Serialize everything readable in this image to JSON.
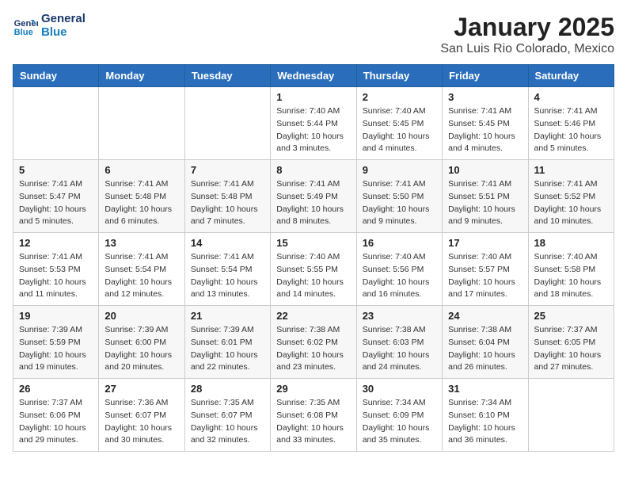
{
  "header": {
    "logo_line1": "General",
    "logo_line2": "Blue",
    "title": "January 2025",
    "subtitle": "San Luis Rio Colorado, Mexico"
  },
  "weekdays": [
    "Sunday",
    "Monday",
    "Tuesday",
    "Wednesday",
    "Thursday",
    "Friday",
    "Saturday"
  ],
  "weeks": [
    [
      {
        "day": "",
        "sunrise": "",
        "sunset": "",
        "daylight": ""
      },
      {
        "day": "",
        "sunrise": "",
        "sunset": "",
        "daylight": ""
      },
      {
        "day": "",
        "sunrise": "",
        "sunset": "",
        "daylight": ""
      },
      {
        "day": "1",
        "sunrise": "Sunrise: 7:40 AM",
        "sunset": "Sunset: 5:44 PM",
        "daylight": "Daylight: 10 hours and 3 minutes."
      },
      {
        "day": "2",
        "sunrise": "Sunrise: 7:40 AM",
        "sunset": "Sunset: 5:45 PM",
        "daylight": "Daylight: 10 hours and 4 minutes."
      },
      {
        "day": "3",
        "sunrise": "Sunrise: 7:41 AM",
        "sunset": "Sunset: 5:45 PM",
        "daylight": "Daylight: 10 hours and 4 minutes."
      },
      {
        "day": "4",
        "sunrise": "Sunrise: 7:41 AM",
        "sunset": "Sunset: 5:46 PM",
        "daylight": "Daylight: 10 hours and 5 minutes."
      }
    ],
    [
      {
        "day": "5",
        "sunrise": "Sunrise: 7:41 AM",
        "sunset": "Sunset: 5:47 PM",
        "daylight": "Daylight: 10 hours and 5 minutes."
      },
      {
        "day": "6",
        "sunrise": "Sunrise: 7:41 AM",
        "sunset": "Sunset: 5:48 PM",
        "daylight": "Daylight: 10 hours and 6 minutes."
      },
      {
        "day": "7",
        "sunrise": "Sunrise: 7:41 AM",
        "sunset": "Sunset: 5:48 PM",
        "daylight": "Daylight: 10 hours and 7 minutes."
      },
      {
        "day": "8",
        "sunrise": "Sunrise: 7:41 AM",
        "sunset": "Sunset: 5:49 PM",
        "daylight": "Daylight: 10 hours and 8 minutes."
      },
      {
        "day": "9",
        "sunrise": "Sunrise: 7:41 AM",
        "sunset": "Sunset: 5:50 PM",
        "daylight": "Daylight: 10 hours and 9 minutes."
      },
      {
        "day": "10",
        "sunrise": "Sunrise: 7:41 AM",
        "sunset": "Sunset: 5:51 PM",
        "daylight": "Daylight: 10 hours and 9 minutes."
      },
      {
        "day": "11",
        "sunrise": "Sunrise: 7:41 AM",
        "sunset": "Sunset: 5:52 PM",
        "daylight": "Daylight: 10 hours and 10 minutes."
      }
    ],
    [
      {
        "day": "12",
        "sunrise": "Sunrise: 7:41 AM",
        "sunset": "Sunset: 5:53 PM",
        "daylight": "Daylight: 10 hours and 11 minutes."
      },
      {
        "day": "13",
        "sunrise": "Sunrise: 7:41 AM",
        "sunset": "Sunset: 5:54 PM",
        "daylight": "Daylight: 10 hours and 12 minutes."
      },
      {
        "day": "14",
        "sunrise": "Sunrise: 7:41 AM",
        "sunset": "Sunset: 5:54 PM",
        "daylight": "Daylight: 10 hours and 13 minutes."
      },
      {
        "day": "15",
        "sunrise": "Sunrise: 7:40 AM",
        "sunset": "Sunset: 5:55 PM",
        "daylight": "Daylight: 10 hours and 14 minutes."
      },
      {
        "day": "16",
        "sunrise": "Sunrise: 7:40 AM",
        "sunset": "Sunset: 5:56 PM",
        "daylight": "Daylight: 10 hours and 16 minutes."
      },
      {
        "day": "17",
        "sunrise": "Sunrise: 7:40 AM",
        "sunset": "Sunset: 5:57 PM",
        "daylight": "Daylight: 10 hours and 17 minutes."
      },
      {
        "day": "18",
        "sunrise": "Sunrise: 7:40 AM",
        "sunset": "Sunset: 5:58 PM",
        "daylight": "Daylight: 10 hours and 18 minutes."
      }
    ],
    [
      {
        "day": "19",
        "sunrise": "Sunrise: 7:39 AM",
        "sunset": "Sunset: 5:59 PM",
        "daylight": "Daylight: 10 hours and 19 minutes."
      },
      {
        "day": "20",
        "sunrise": "Sunrise: 7:39 AM",
        "sunset": "Sunset: 6:00 PM",
        "daylight": "Daylight: 10 hours and 20 minutes."
      },
      {
        "day": "21",
        "sunrise": "Sunrise: 7:39 AM",
        "sunset": "Sunset: 6:01 PM",
        "daylight": "Daylight: 10 hours and 22 minutes."
      },
      {
        "day": "22",
        "sunrise": "Sunrise: 7:38 AM",
        "sunset": "Sunset: 6:02 PM",
        "daylight": "Daylight: 10 hours and 23 minutes."
      },
      {
        "day": "23",
        "sunrise": "Sunrise: 7:38 AM",
        "sunset": "Sunset: 6:03 PM",
        "daylight": "Daylight: 10 hours and 24 minutes."
      },
      {
        "day": "24",
        "sunrise": "Sunrise: 7:38 AM",
        "sunset": "Sunset: 6:04 PM",
        "daylight": "Daylight: 10 hours and 26 minutes."
      },
      {
        "day": "25",
        "sunrise": "Sunrise: 7:37 AM",
        "sunset": "Sunset: 6:05 PM",
        "daylight": "Daylight: 10 hours and 27 minutes."
      }
    ],
    [
      {
        "day": "26",
        "sunrise": "Sunrise: 7:37 AM",
        "sunset": "Sunset: 6:06 PM",
        "daylight": "Daylight: 10 hours and 29 minutes."
      },
      {
        "day": "27",
        "sunrise": "Sunrise: 7:36 AM",
        "sunset": "Sunset: 6:07 PM",
        "daylight": "Daylight: 10 hours and 30 minutes."
      },
      {
        "day": "28",
        "sunrise": "Sunrise: 7:35 AM",
        "sunset": "Sunset: 6:07 PM",
        "daylight": "Daylight: 10 hours and 32 minutes."
      },
      {
        "day": "29",
        "sunrise": "Sunrise: 7:35 AM",
        "sunset": "Sunset: 6:08 PM",
        "daylight": "Daylight: 10 hours and 33 minutes."
      },
      {
        "day": "30",
        "sunrise": "Sunrise: 7:34 AM",
        "sunset": "Sunset: 6:09 PM",
        "daylight": "Daylight: 10 hours and 35 minutes."
      },
      {
        "day": "31",
        "sunrise": "Sunrise: 7:34 AM",
        "sunset": "Sunset: 6:10 PM",
        "daylight": "Daylight: 10 hours and 36 minutes."
      },
      {
        "day": "",
        "sunrise": "",
        "sunset": "",
        "daylight": ""
      }
    ]
  ]
}
